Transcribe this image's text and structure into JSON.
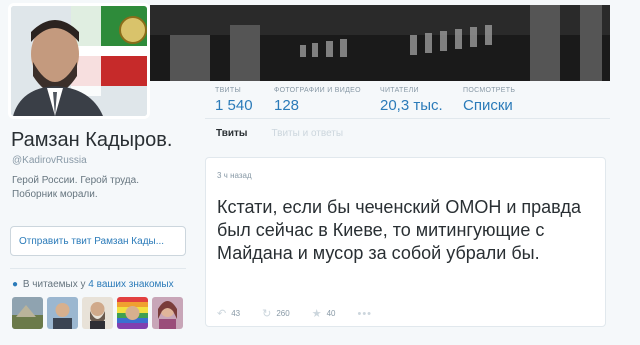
{
  "profile": {
    "name": "Рамзан Кадыров.",
    "handle": "@KadirovRussia",
    "bio": "Герой России. Герой труда. Поборник морали."
  },
  "tweet_box": {
    "placeholder": "Отправить твит Рамзан Кады..."
  },
  "followers": {
    "prefix": "В читаемых у",
    "highlight": "4 ваших знакомых",
    "icon": "user-icon"
  },
  "stats": [
    {
      "label": "ТВИТЫ",
      "value": "1 540"
    },
    {
      "label": "ФОТОГРАФИИ И ВИДЕО",
      "value": "128"
    },
    {
      "label": "ЧИТАТЕЛИ",
      "value": "20,3 тыс."
    },
    {
      "label": "ПОСМОТРЕТЬ",
      "value": "Списки"
    }
  ],
  "tabs": [
    {
      "label": "Твиты",
      "active": true
    },
    {
      "label": "Твиты и ответы",
      "active": false
    }
  ],
  "tweet": {
    "time": "3 ч назад",
    "text": "Кстати, если бы чеченский ОМОН и правда был сейчас в Киеве, то митингующие с Майдана и мусор за собой убрали бы.",
    "replies": "43",
    "retweets": "260",
    "favorites": "40"
  },
  "colors": {
    "link": "#2b7bb9",
    "muted": "#8899a6",
    "background": "#f5f8fa"
  }
}
